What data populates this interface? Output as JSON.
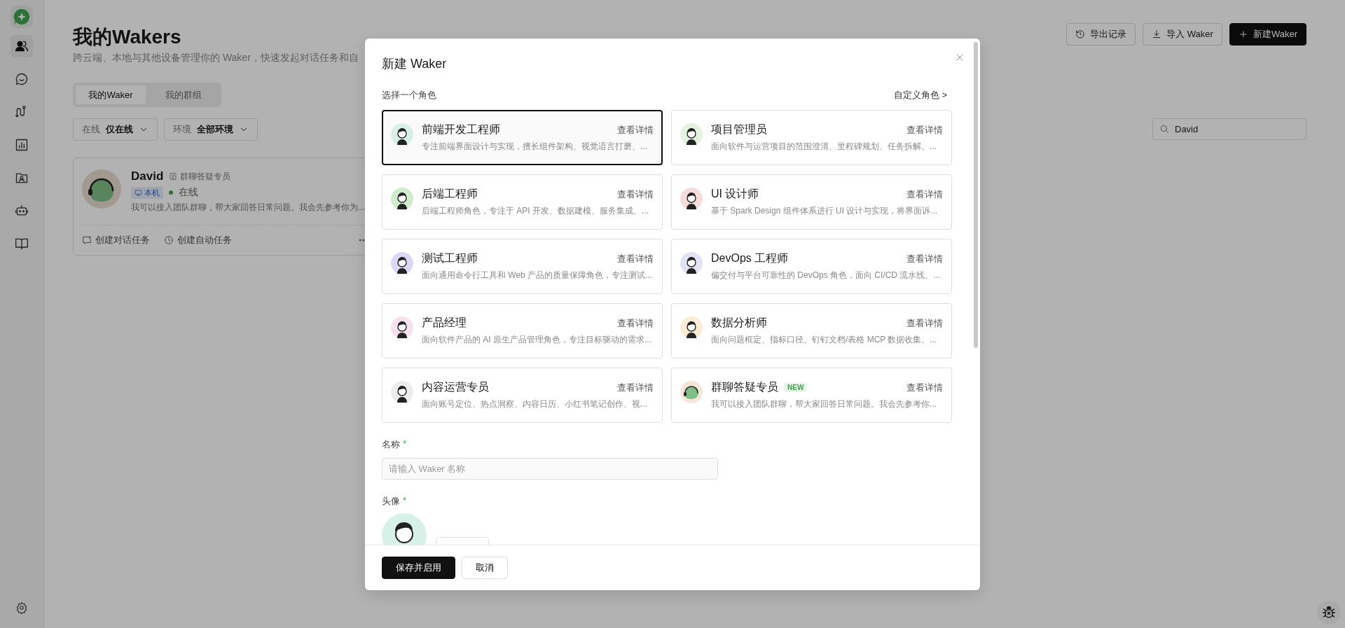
{
  "sidebar": {
    "items": [
      {
        "kind": "users",
        "selected": true
      },
      {
        "kind": "chat",
        "selected": false
      },
      {
        "kind": "flow",
        "selected": false
      },
      {
        "kind": "chart",
        "selected": false
      },
      {
        "kind": "contact",
        "selected": false
      },
      {
        "kind": "robot",
        "selected": false
      },
      {
        "kind": "book",
        "selected": false
      }
    ]
  },
  "page": {
    "title": "我的Wakers",
    "subtitle": "跨云端、本地与其他设备管理你的 Waker，快速发起对话任务和自"
  },
  "header_buttons": [
    {
      "label": "导出记录",
      "kind": "history",
      "primary": false
    },
    {
      "label": "导入 Waker",
      "kind": "import",
      "primary": false
    },
    {
      "label": "新建Waker",
      "kind": "add",
      "primary": true
    }
  ],
  "tabs": [
    {
      "label": "我的Waker",
      "selected": true
    },
    {
      "label": "我的群组",
      "selected": false
    }
  ],
  "filters": [
    {
      "label": "在线",
      "value": "仅在线"
    },
    {
      "label": "环境",
      "value": "全部环境"
    }
  ],
  "search": {
    "value": "David"
  },
  "waker_card": {
    "name": "David",
    "role": "群聊答疑专员",
    "location_badge": "本机",
    "status": "在线",
    "online": true,
    "description": "我可以接入团队群聊，帮大家回答日常问题。我会先参考你为...",
    "actions": [
      {
        "label": "创建对话任务",
        "kind": "chat"
      },
      {
        "label": "创建自动任务",
        "kind": "clock"
      }
    ]
  },
  "dialog": {
    "title": "新建 Waker",
    "section_label": "选择一个角色",
    "custom_link": "自定义角色 >",
    "roles": [
      {
        "title": "前端开发工程师",
        "detail_link": "查看详情",
        "description": "专注前端界面设计与实现，擅长组件架构、视觉语言打磨、...",
        "selected": true,
        "color": "#d8f1e8",
        "kind": "person"
      },
      {
        "title": "项目管理员",
        "detail_link": "查看详情",
        "description": "面向软件与运营项目的范围澄清、里程碑规划、任务拆解、...",
        "selected": false,
        "color": "#e3f3df",
        "kind": "person"
      },
      {
        "title": "后端工程师",
        "detail_link": "查看详情",
        "description": "后端工程师角色，专注于 API 开发、数据建模、服务集成、...",
        "selected": false,
        "color": "#cfeccb",
        "kind": "person"
      },
      {
        "title": "UI 设计师",
        "detail_link": "查看详情",
        "description": "基于 Spark Design 组件体系进行 UI 设计与实现，将界面诉...",
        "selected": false,
        "color": "#f7dcdc",
        "kind": "person"
      },
      {
        "title": "测试工程师",
        "detail_link": "查看详情",
        "description": "面向通用命令行工具和 Web 产品的质量保障角色，专注测试...",
        "selected": false,
        "color": "#ddd6f7",
        "kind": "person"
      },
      {
        "title": "DevOps 工程师",
        "detail_link": "查看详情",
        "description": "偏交付与平台可靠性的 DevOps 角色，面向 CI/CD 流水线、...",
        "selected": false,
        "color": "#e2e2f5",
        "kind": "person"
      },
      {
        "title": "产品经理",
        "detail_link": "查看详情",
        "description": "面向软件产品的 AI 原生产品管理角色，专注目标驱动的需求...",
        "selected": false,
        "color": "#f6e1ec",
        "kind": "person"
      },
      {
        "title": "数据分析师",
        "detail_link": "查看详情",
        "description": "面向问题框定、指标口径、钉钉文档/表格 MCP 数据收集、...",
        "selected": false,
        "color": "#fbecd6",
        "kind": "person"
      },
      {
        "title": "内容运营专员",
        "detail_link": "查看详情",
        "description": "面向账号定位、热点洞察、内容日历、小红书笔记创作、视...",
        "selected": false,
        "color": "#ececec",
        "kind": "person"
      },
      {
        "title": "群聊答疑专员",
        "detail_link": "查看详情",
        "description": "我可以接入团队群聊，帮大家回答日常问题。我会先参考你...",
        "selected": false,
        "color": "#f6e6d8",
        "kind": "bot",
        "badge": "NEW"
      }
    ],
    "name_field": {
      "label": "名称",
      "required_mark": "*",
      "placeholder": "请输入 Waker 名称"
    },
    "avatar_field": {
      "label": "头像",
      "required_mark": "*"
    },
    "buttons": [
      {
        "label": "保存并启用",
        "primary": true
      },
      {
        "label": "取消",
        "primary": false
      }
    ]
  }
}
